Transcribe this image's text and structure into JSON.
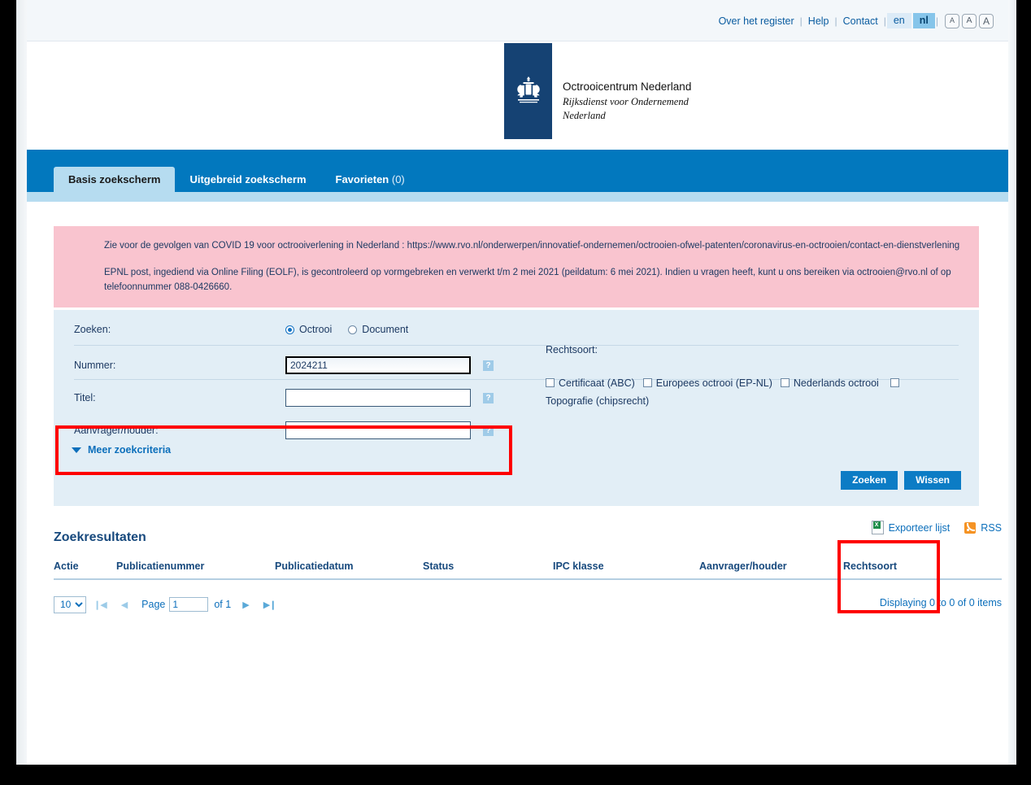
{
  "topbar": {
    "links": [
      "Over het register",
      "Help",
      "Contact"
    ],
    "languages": [
      {
        "code": "en",
        "active": false
      },
      {
        "code": "nl",
        "active": true
      }
    ],
    "text_size_buttons": [
      "A",
      "A",
      "A"
    ]
  },
  "logo": {
    "icon": "dutch-coat-of-arms-icon",
    "title": "Octrooicentrum Nederland",
    "subtitle_line1": "Rijksdienst voor Ondernemend",
    "subtitle_line2": "Nederland",
    "bar_color": "#154273"
  },
  "nav": {
    "tabs": [
      {
        "label": "Basis zoekscherm",
        "count": "",
        "active": true
      },
      {
        "label": "Uitgebreid zoekscherm",
        "count": "",
        "active": false
      },
      {
        "label": "Favorieten",
        "count": "(0)",
        "active": false
      }
    ],
    "background": "#0278be"
  },
  "alert": {
    "paragraph1": "Zie voor de gevolgen van COVID 19 voor octrooiverlening in Nederland : https://www.rvo.nl/onderwerpen/innovatief-ondernemen/octrooien-ofwel-patenten/coronavirus-en-octrooien/contact-en-dienstverlening",
    "paragraph2": "EPNL post, ingediend via Online Filing (EOLF), is gecontroleerd op vormgebreken en verwerkt t/m 2 mei 2021 (peildatum: 6 mei 2021). Indien u vragen heeft, kunt u ons bereiken via octrooien@rvo.nl of op telefoonnummer 088-0426660.",
    "background": "#f9c4cf"
  },
  "search": {
    "zoeken_label": "Zoeken:",
    "radios": [
      {
        "label": "Octrooi",
        "checked": true
      },
      {
        "label": "Document",
        "checked": false
      }
    ],
    "fields": [
      {
        "label": "Nummer:",
        "value": "2024211",
        "placeholder": "",
        "focused": true,
        "help": "?"
      },
      {
        "label": "Titel:",
        "value": "",
        "placeholder": "",
        "focused": false,
        "help": "?"
      },
      {
        "label": "Aanvrager/houder:",
        "value": "",
        "placeholder": "",
        "focused": false,
        "help": "?"
      }
    ],
    "more_criteria": "Meer zoekcriteria",
    "rechtsoort_label": "Rechtsoort:",
    "rechtsoort_options": [
      {
        "label": "Certificaat (ABC)",
        "checked": false
      },
      {
        "label": "Europees octrooi (EP-NL)",
        "checked": false
      },
      {
        "label": "Nederlands octrooi",
        "checked": false
      },
      {
        "label": "Topografie (chipsrecht)",
        "checked": false
      }
    ],
    "buttons": {
      "search": "Zoeken",
      "clear": "Wissen"
    },
    "panel_background": "#e2eef6"
  },
  "highlights": {
    "color": "#fe0000",
    "boxes": [
      {
        "name": "nummer-field-highlight"
      },
      {
        "name": "zoeken-button-highlight"
      }
    ]
  },
  "results": {
    "title": "Zoekresultaten",
    "export_label": "Exporteer lijst",
    "rss_label": "RSS",
    "columns": [
      "Actie",
      "Publicatienummer",
      "Publicatiedatum",
      "Status",
      "IPC klasse",
      "Aanvrager/houder",
      "Rechtsoort"
    ],
    "rows": [],
    "pager": {
      "page_size": "10",
      "page_label": "Page",
      "page_value": "1",
      "of_label": "of 1",
      "first_icon": "❙◀",
      "prev_icon": "◀",
      "next_icon": "▶",
      "last_icon": "▶❙",
      "displaying": "Displaying 0 to 0 of 0 items"
    }
  }
}
